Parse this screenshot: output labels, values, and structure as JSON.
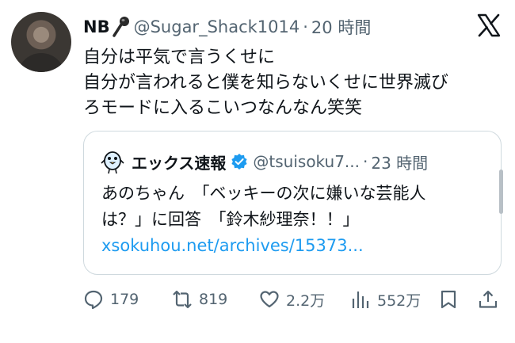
{
  "tweet": {
    "author_name": "NB",
    "name_emoji_icon": "microphone-icon",
    "handle": "@Sugar_Shack1014",
    "separator": "·",
    "time": "20 時間",
    "lines": [
      "自分は平気で言うくせに",
      "自分が言われると僕を知らないくせに世界滅び",
      "ろモードに入るこいつなんなん笑笑"
    ]
  },
  "quote": {
    "name": "エックス速報",
    "handle": "@tsuisoku7...",
    "separator": "·",
    "time": "23 時間",
    "lines": [
      "あのちゃん　「ベッキーの次に嫌いな芸能人",
      "は？」に回答　「鈴木紗理奈！！」"
    ],
    "link": "xsokuhou.net/archives/15373..."
  },
  "actions": {
    "replies": "179",
    "retweets": "819",
    "likes": "2.2万",
    "views": "552万"
  },
  "colors": {
    "text": "#0f1419",
    "secondary": "#536471",
    "link": "#1d9bf0",
    "border": "#cfd9de"
  }
}
